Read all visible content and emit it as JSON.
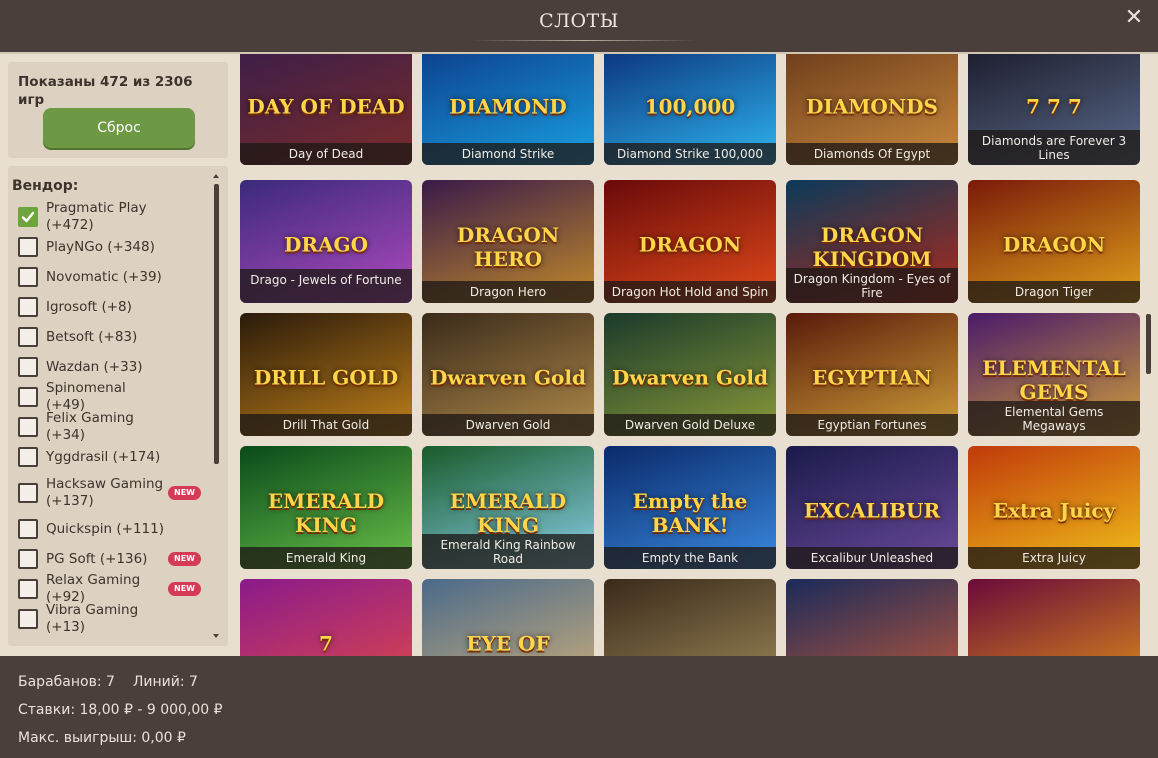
{
  "header": {
    "title": "СЛОТЫ",
    "close_glyph": "✕"
  },
  "summary": {
    "shown_text": "Показаны 472 из 2306 игр",
    "reset_label": "Сброс"
  },
  "vendor": {
    "title": "Вендор:",
    "new_badge": "NEW",
    "items": [
      {
        "label": "Pragmatic Play (+472)",
        "checked": true
      },
      {
        "label": "PlayNGo (+348)"
      },
      {
        "label": "Novomatic (+39)"
      },
      {
        "label": "Igrosoft (+8)"
      },
      {
        "label": "Betsoft (+83)"
      },
      {
        "label": "Wazdan (+33)"
      },
      {
        "label": "Spinomenal (+49)"
      },
      {
        "label": "Felix Gaming (+34)"
      },
      {
        "label": "Yggdrasil (+174)"
      },
      {
        "label": "Hacksaw Gaming (+137)",
        "new": true
      },
      {
        "label": "Quickspin (+111)"
      },
      {
        "label": "PG Soft (+136)",
        "new": true
      },
      {
        "label": "Relax Gaming (+92)",
        "new": true
      },
      {
        "label": "Vibra Gaming (+13)"
      }
    ]
  },
  "games": [
    {
      "title": "Day of Dead",
      "logo": "DAY OF DEAD",
      "c1": "#3a1d4a",
      "c2": "#7a2d2a"
    },
    {
      "title": "Diamond Strike",
      "logo": "DIAMOND",
      "c1": "#0c3c8a",
      "c2": "#1aa0e0"
    },
    {
      "title": "Diamond Strike 100,000",
      "logo": "100,000",
      "c1": "#0a2f7a",
      "c2": "#2fb5ee"
    },
    {
      "title": "Diamonds Of Egypt",
      "logo": "DIAMONDS",
      "c1": "#6a3a1a",
      "c2": "#c98a3e"
    },
    {
      "title": "Diamonds are Forever 3 Lines",
      "logo": "7 7 7",
      "c1": "#1a1a2a",
      "c2": "#5a6a8a"
    },
    {
      "title": "Drago - Jewels of Fortune",
      "logo": "DRAGO",
      "c1": "#3b2a7a",
      "c2": "#b04ac0"
    },
    {
      "title": "Dragon Hero",
      "logo": "DRAGON HERO",
      "c1": "#3a1a4a",
      "c2": "#c08a2a"
    },
    {
      "title": "Dragon Hot Hold and Spin",
      "logo": "DRAGON",
      "c1": "#6a0a0a",
      "c2": "#e04a1a"
    },
    {
      "title": "Dragon Kingdom - Eyes of Fire",
      "logo": "DRAGON KINGDOM",
      "c1": "#0a3a5a",
      "c2": "#b02a1a"
    },
    {
      "title": "Dragon Tiger",
      "logo": "DRAGON",
      "c1": "#7a1a0a",
      "c2": "#e0a01a"
    },
    {
      "title": "Drill That Gold",
      "logo": "DRILL GOLD",
      "c1": "#2a1a0a",
      "c2": "#c0801a"
    },
    {
      "title": "Dwarven Gold",
      "logo": "Dwarven Gold",
      "c1": "#3a2a1a",
      "c2": "#b08a4a"
    },
    {
      "title": "Dwarven Gold Deluxe",
      "logo": "Dwarven Gold",
      "c1": "#1a3a2a",
      "c2": "#8a9a3a"
    },
    {
      "title": "Egyptian Fortunes",
      "logo": "EGYPTIAN",
      "c1": "#5a1a0a",
      "c2": "#d0a03a"
    },
    {
      "title": "Elemental Gems Megaways",
      "logo": "ELEMENTAL GEMS",
      "c1": "#4a1a6a",
      "c2": "#d0a03a"
    },
    {
      "title": "Emerald King",
      "logo": "EMERALD KING",
      "c1": "#0a4a1a",
      "c2": "#6ac04a"
    },
    {
      "title": "Emerald King Rainbow Road",
      "logo": "EMERALD KING",
      "c1": "#1a5a2a",
      "c2": "#8ad0ea"
    },
    {
      "title": "Empty the Bank",
      "logo": "Empty the BANK!",
      "c1": "#0a2a6a",
      "c2": "#3a8ae0"
    },
    {
      "title": "Excalibur Unleashed",
      "logo": "EXCALIBUR",
      "c1": "#1a1a4a",
      "c2": "#6a4a9a"
    },
    {
      "title": "Extra Juicy",
      "logo": "Extra Juicy",
      "c1": "#c03a0a",
      "c2": "#f0c01a"
    },
    {
      "title": "",
      "logo": "7",
      "c1": "#8a1a8a",
      "c2": "#e04a4a"
    },
    {
      "title": "",
      "logo": "EYE OF",
      "c1": "#4a6a8a",
      "c2": "#d0b07a"
    },
    {
      "title": "",
      "logo": "",
      "c1": "#3a2a1a",
      "c2": "#a08a5a"
    },
    {
      "title": "",
      "logo": "",
      "c1": "#1a2a5a",
      "c2": "#c05a3a"
    },
    {
      "title": "",
      "logo": "",
      "c1": "#6a0a3a",
      "c2": "#e0901a"
    }
  ],
  "footer": {
    "reels": "Барабанов: 7",
    "lines": "Линий: 7",
    "bets": "Ставки: 18,00 ₽ - 9 000,00 ₽",
    "max_win": "Макс. выигрыш: 0,00 ₽"
  }
}
